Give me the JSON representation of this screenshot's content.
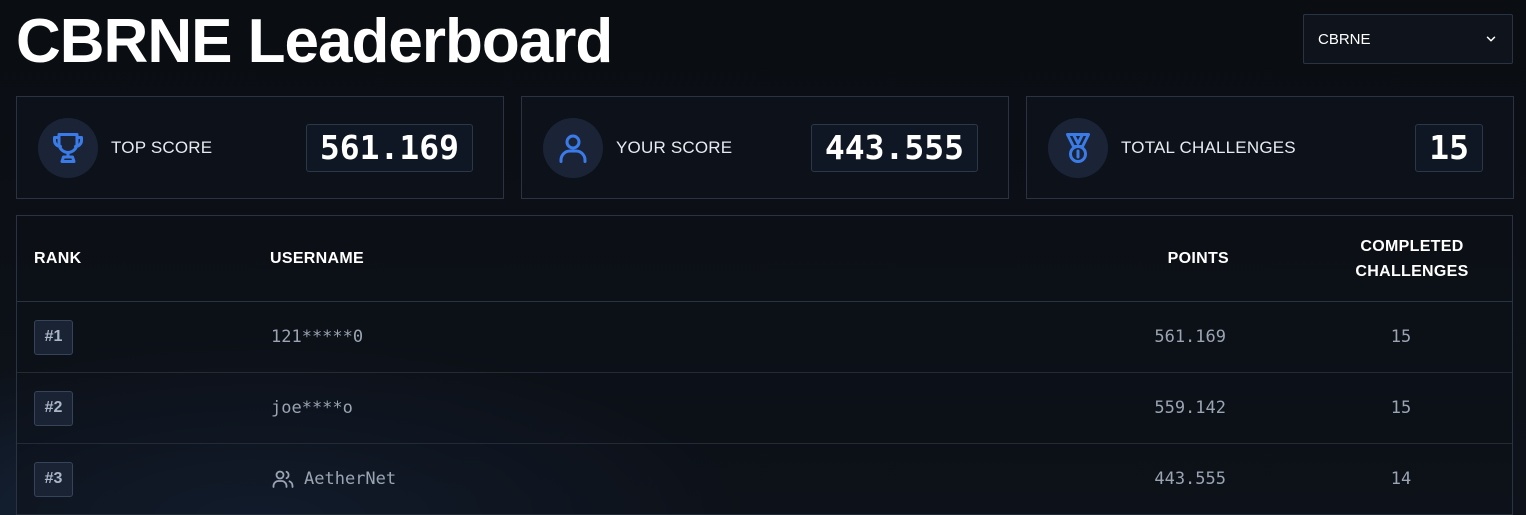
{
  "page": {
    "title": "CBRNE Leaderboard"
  },
  "category_select": {
    "value": "CBRNE",
    "icon": "chevron-down-icon"
  },
  "stats": [
    {
      "label": "TOP SCORE",
      "value": "561.169",
      "icon": "trophy-icon"
    },
    {
      "label": "YOUR SCORE",
      "value": "443.555",
      "icon": "user-icon"
    },
    {
      "label": "TOTAL CHALLENGES",
      "value": "15",
      "icon": "medal-icon"
    }
  ],
  "table": {
    "headers": {
      "rank": "RANK",
      "username": "USERNAME",
      "points": "POINTS",
      "completed": "COMPLETED CHALLENGES"
    },
    "rows": [
      {
        "rank": "#1",
        "username": "121*****0",
        "points": "561.169",
        "completed": "15",
        "is_team": false
      },
      {
        "rank": "#2",
        "username": "joe****o",
        "points": "559.142",
        "completed": "15",
        "is_team": false
      },
      {
        "rank": "#3",
        "username": "AetherNet",
        "points": "443.555",
        "completed": "14",
        "is_team": true,
        "icon": "team-icon"
      }
    ]
  },
  "colors": {
    "accent": "#3b7be8",
    "background": "#0d1118",
    "border": "#2a3342"
  }
}
